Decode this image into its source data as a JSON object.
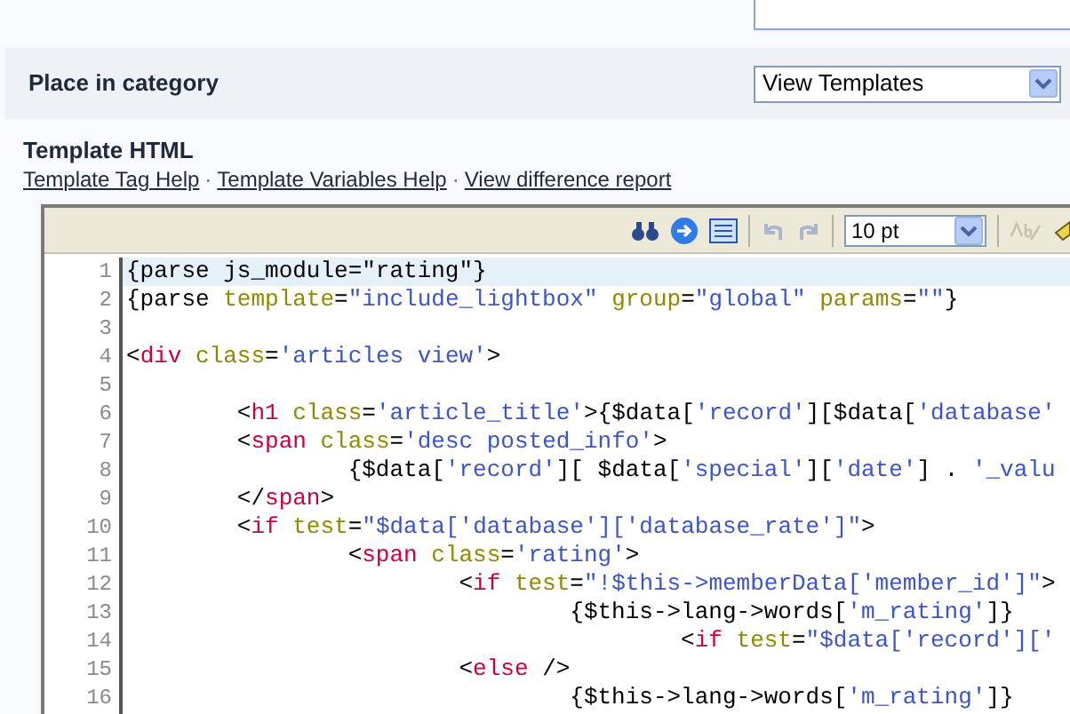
{
  "category": {
    "label": "Place in category",
    "select": "View Templates"
  },
  "template": {
    "title": "Template HTML",
    "links": [
      "Template Tag Help",
      "Template Variables Help",
      "View difference report"
    ],
    "separator": "·"
  },
  "editor": {
    "font_size": "10 pt",
    "lines": [
      {
        "number": "1",
        "selected": true,
        "tokens": [
          {
            "kind": "plain",
            "text": "{parse js_module=\"rating\"}"
          }
        ]
      },
      {
        "number": "2",
        "selected": false,
        "tokens": [
          {
            "kind": "plain",
            "text": "{parse "
          },
          {
            "kind": "attr",
            "text": "template"
          },
          {
            "kind": "plain",
            "text": "="
          },
          {
            "kind": "string",
            "text": "\"include_lightbox\""
          },
          {
            "kind": "attr",
            "text": " group"
          },
          {
            "kind": "plain",
            "text": "="
          },
          {
            "kind": "string",
            "text": "\"global\""
          },
          {
            "kind": "attr",
            "text": " params"
          },
          {
            "kind": "plain",
            "text": "="
          },
          {
            "kind": "string",
            "text": "\"\""
          },
          {
            "kind": "plain",
            "text": "}"
          }
        ]
      },
      {
        "number": "3",
        "selected": false
      },
      {
        "number": "4",
        "selected": false,
        "tokens": [
          {
            "kind": "plain",
            "text": "<"
          },
          {
            "kind": "tag",
            "text": "div"
          },
          {
            "kind": "attr",
            "text": " class"
          },
          {
            "kind": "plain",
            "text": "="
          },
          {
            "kind": "string",
            "text": "'articles view'"
          },
          {
            "kind": "plain",
            "text": ">"
          }
        ]
      },
      {
        "number": "5",
        "selected": false
      },
      {
        "number": "6",
        "selected": false,
        "tokens": [
          {
            "kind": "plain",
            "text": "        <"
          },
          {
            "kind": "tag",
            "text": "h1"
          },
          {
            "kind": "attr",
            "text": " class"
          },
          {
            "kind": "plain",
            "text": "="
          },
          {
            "kind": "string",
            "text": "'article_title'"
          },
          {
            "kind": "plain",
            "text": ">{$data["
          },
          {
            "kind": "string",
            "text": "'record'"
          },
          {
            "kind": "plain",
            "text": "][$data["
          },
          {
            "kind": "string",
            "text": "'database'"
          }
        ]
      },
      {
        "number": "7",
        "selected": false,
        "tokens": [
          {
            "kind": "plain",
            "text": "        <"
          },
          {
            "kind": "tag",
            "text": "span"
          },
          {
            "kind": "attr",
            "text": " class"
          },
          {
            "kind": "plain",
            "text": "="
          },
          {
            "kind": "string",
            "text": "'desc posted_info'"
          },
          {
            "kind": "plain",
            "text": ">"
          }
        ]
      },
      {
        "number": "8",
        "selected": false,
        "tokens": [
          {
            "kind": "plain",
            "text": "                {$data["
          },
          {
            "kind": "string",
            "text": "'record'"
          },
          {
            "kind": "plain",
            "text": "][ $data["
          },
          {
            "kind": "string",
            "text": "'special'"
          },
          {
            "kind": "plain",
            "text": "]["
          },
          {
            "kind": "string",
            "text": "'date'"
          },
          {
            "kind": "plain",
            "text": "] . "
          },
          {
            "kind": "string",
            "text": "'_valu"
          }
        ]
      },
      {
        "number": "9",
        "selected": false,
        "tokens": [
          {
            "kind": "plain",
            "text": "        </"
          },
          {
            "kind": "tag",
            "text": "span"
          },
          {
            "kind": "plain",
            "text": ">"
          }
        ]
      },
      {
        "number": "10",
        "selected": false,
        "tokens": [
          {
            "kind": "plain",
            "text": "        <"
          },
          {
            "kind": "tag",
            "text": "if"
          },
          {
            "kind": "attr",
            "text": " test"
          },
          {
            "kind": "plain",
            "text": "="
          },
          {
            "kind": "string",
            "text": "\"$data['database']['database_rate']\""
          },
          {
            "kind": "plain",
            "text": ">"
          }
        ]
      },
      {
        "number": "11",
        "selected": false,
        "tokens": [
          {
            "kind": "plain",
            "text": "                <"
          },
          {
            "kind": "tag",
            "text": "span"
          },
          {
            "kind": "attr",
            "text": " class"
          },
          {
            "kind": "plain",
            "text": "="
          },
          {
            "kind": "string",
            "text": "'rating'"
          },
          {
            "kind": "plain",
            "text": ">"
          }
        ]
      },
      {
        "number": "12",
        "selected": false,
        "tokens": [
          {
            "kind": "plain",
            "text": "                        <"
          },
          {
            "kind": "tag",
            "text": "if"
          },
          {
            "kind": "attr",
            "text": " test"
          },
          {
            "kind": "plain",
            "text": "="
          },
          {
            "kind": "string",
            "text": "\"!$this->memberData['member_id']\""
          },
          {
            "kind": "plain",
            "text": ">"
          }
        ]
      },
      {
        "number": "13",
        "selected": false,
        "tokens": [
          {
            "kind": "plain",
            "text": "                                {$this->lang->words["
          },
          {
            "kind": "string",
            "text": "'m_rating'"
          },
          {
            "kind": "plain",
            "text": "]}"
          }
        ]
      },
      {
        "number": "14",
        "selected": false,
        "tokens": [
          {
            "kind": "plain",
            "text": "                                        <"
          },
          {
            "kind": "tag",
            "text": "if"
          },
          {
            "kind": "attr",
            "text": " test"
          },
          {
            "kind": "plain",
            "text": "="
          },
          {
            "kind": "string",
            "text": "\"$data['record']['"
          }
        ]
      },
      {
        "number": "15",
        "selected": false,
        "tokens": [
          {
            "kind": "plain",
            "text": "                        <"
          },
          {
            "kind": "tag",
            "text": "else"
          },
          {
            "kind": "plain",
            "text": " />"
          }
        ]
      },
      {
        "number": "16",
        "selected": false,
        "tokens": [
          {
            "kind": "plain",
            "text": "                                {$this->lang->words["
          },
          {
            "kind": "string",
            "text": "'m_rating'"
          },
          {
            "kind": "plain",
            "text": "]}"
          }
        ]
      }
    ]
  }
}
